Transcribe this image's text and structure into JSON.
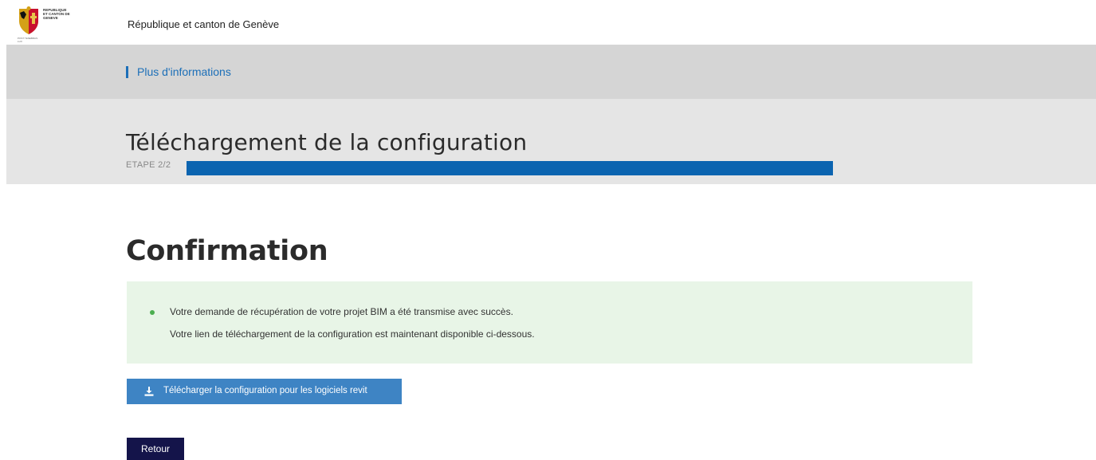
{
  "header": {
    "logo_text": "REPUBLIQUE ET CANTON DE GENEVE",
    "logo_subtext": "POST TENEBRAS LUX",
    "site_title": "République et canton de Genève"
  },
  "infobar": {
    "link_label": "Plus d'informations"
  },
  "wizard": {
    "title": "Téléchargement de la configuration",
    "step_label": "ETAPE 2/2",
    "progress_fraction": 1.0
  },
  "confirmation": {
    "title": "Confirmation",
    "message_line1": "Votre demande de récupération de votre projet BIM a été transmise avec succès.",
    "message_line2": "Votre lien de téléchargement de la configuration est maintenant disponible ci-dessous."
  },
  "actions": {
    "download_label": "Télécharger la configuration pour les logiciels revit",
    "download_icon": "download-icon",
    "back_label": "Retour"
  },
  "colors": {
    "accent_blue": "#0b64b0",
    "button_blue": "#3e84c4",
    "back_button": "#14144a",
    "success_bg": "#e8f5e7",
    "success_dot": "#4caf50"
  }
}
